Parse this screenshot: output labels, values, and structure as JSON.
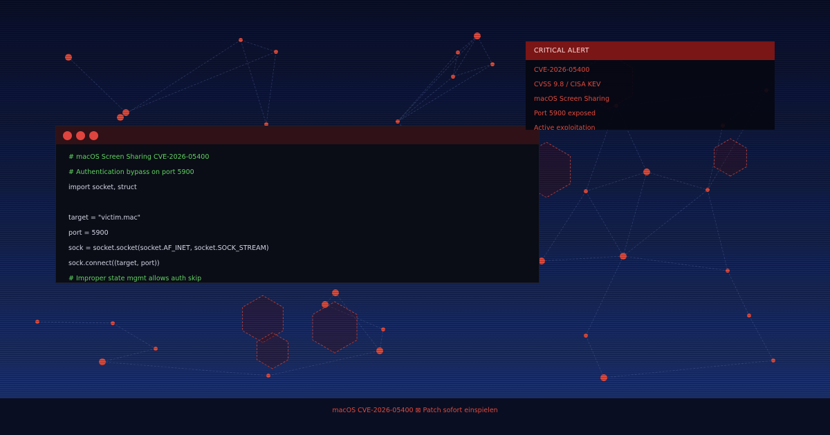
{
  "terminal": {
    "lines": [
      {
        "text": "# macOS Screen Sharing CVE-2026-05400",
        "kind": "comment"
      },
      {
        "text": "# Authentication bypass on port 5900",
        "kind": "comment"
      },
      {
        "text": "import socket, struct",
        "kind": "code"
      },
      {
        "text": "",
        "kind": "code"
      },
      {
        "text": "target = \"victim.mac\"",
        "kind": "code"
      },
      {
        "text": "port = 5900",
        "kind": "code"
      },
      {
        "text": "sock = socket.socket(socket.AF_INET, socket.SOCK_STREAM)",
        "kind": "code"
      },
      {
        "text": "sock.connect((target, port))",
        "kind": "code"
      },
      {
        "text": "# Improper state mgmt allows auth skip",
        "kind": "comment"
      }
    ]
  },
  "alert": {
    "title": "CRITICAL ALERT",
    "items": [
      "CVE-2026-05400",
      "CVSS 9.8 / CISA KEV",
      "macOS Screen Sharing",
      "Port 5900 exposed",
      "Active exploitation"
    ]
  },
  "footer": {
    "text": "macOS CVE-2026-05400 ⊠ Patch sofort einspielen"
  },
  "colors": {
    "accent_red": "#e04a3c",
    "comment_green": "#5fd35f",
    "alert_header": "#7a1616",
    "terminal_titlebar": "#2f1117",
    "background_top": "#0a0f2a",
    "background_bottom": "#1d3476"
  }
}
